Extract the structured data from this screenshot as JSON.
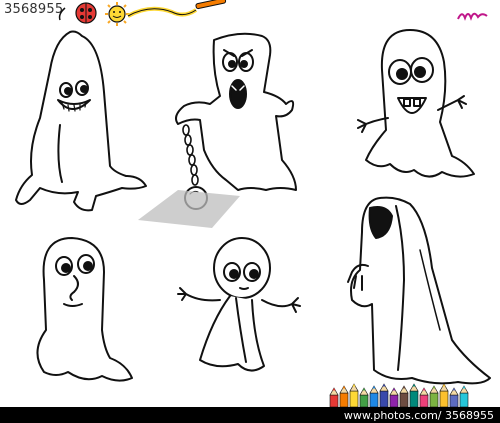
{
  "image": {
    "stock_id": "3568955",
    "footer_credit": "www.photos.com/ 3568955",
    "palette": {
      "ink": "#111111",
      "paper": "#ffffff",
      "banner_magenta": "#c0178a",
      "pencil_colors": [
        "#e53935",
        "#f57c00",
        "#fdd835",
        "#43a047",
        "#1e88e5",
        "#3949ab",
        "#8e24aa",
        "#6d4c41",
        "#00897b",
        "#ec407a",
        "#7cb342",
        "#fbc02d",
        "#5c6bc0",
        "#26c6da"
      ]
    },
    "icons": {
      "header_left": "ladybug-sun-paintbrush-icon",
      "header_right": "handwritten-m-icon",
      "footer": "colored-pencils-icon"
    },
    "ghosts": [
      {
        "name": "tall-smiling-ghost"
      },
      {
        "name": "screaming-chained-ghost"
      },
      {
        "name": "big-eyed-toothy-ghost"
      },
      {
        "name": "shy-round-ghost"
      },
      {
        "name": "waving-alien-ghost"
      },
      {
        "name": "hooded-reaper-ghost"
      }
    ]
  }
}
